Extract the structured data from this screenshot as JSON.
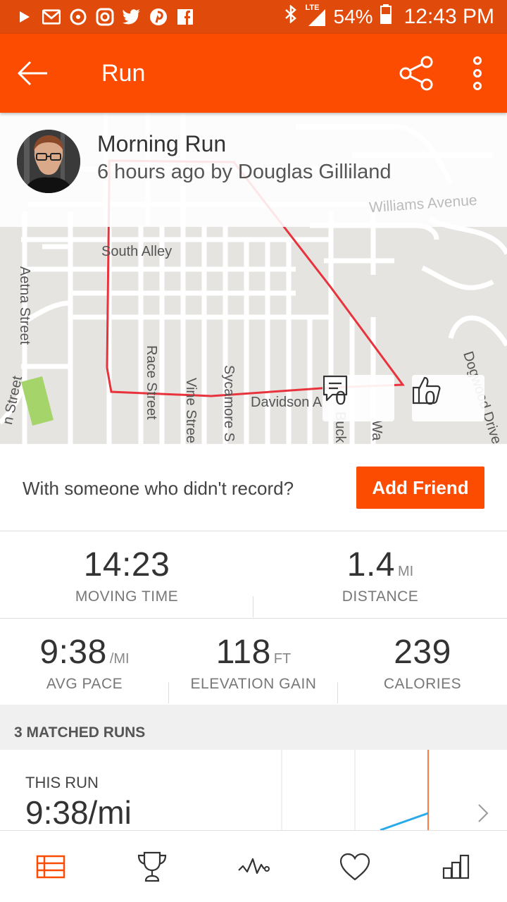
{
  "status_bar": {
    "battery": "54%",
    "network": "LTE",
    "time": "12:43 PM",
    "icons": [
      "play-icon",
      "gmail-icon",
      "sync-icon",
      "instagram-icon",
      "twitter-icon",
      "pinterest-icon",
      "facebook-icon",
      "bluetooth-icon",
      "signal-icon",
      "battery-icon"
    ]
  },
  "toolbar": {
    "title": "Run",
    "accent": "#fc4c02"
  },
  "activity": {
    "title": "Morning Run",
    "subtitle": "6 hours ago by Douglas Gilliland",
    "comments": "0",
    "kudos": "0"
  },
  "map_labels": {
    "south_alley": "South Alley",
    "aetna": "Aetna Street",
    "race": "Race Street",
    "vine": "Vine Stree",
    "sycamore": "Sycamore S",
    "davidson": "Davidson A",
    "williams": "Williams Avenue",
    "dogwood": "Dogwood Drive",
    "street_left": "n Street",
    "buck": "Buck",
    "wa": "Wa"
  },
  "friend": {
    "prompt": "With someone who didn't record?",
    "button": "Add Friend"
  },
  "stats": {
    "moving_time": {
      "value": "14:23",
      "label": "MOVING TIME"
    },
    "distance": {
      "value": "1.4",
      "unit": "MI",
      "label": "DISTANCE"
    },
    "avg_pace": {
      "value": "9:38",
      "unit": "/MI",
      "label": "AVG PACE"
    },
    "elevation": {
      "value": "118",
      "unit": "FT",
      "label": "ELEVATION GAIN"
    },
    "calories": {
      "value": "239",
      "label": "CALORIES"
    }
  },
  "matched": {
    "header": "3 MATCHED RUNS",
    "this_run_label": "THIS RUN",
    "this_run_value": "9:38/mi"
  },
  "bottom_nav": [
    "feed-icon",
    "trophy-icon",
    "activity-icon",
    "heart-icon",
    "stats-icon"
  ]
}
